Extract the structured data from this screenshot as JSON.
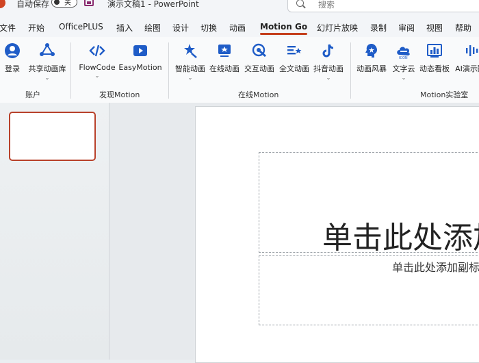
{
  "titlebar": {
    "autosave_label": "自动保存",
    "autosave_state": "关",
    "doc_title": "演示文稿1  -  PowerPoint",
    "search_placeholder": "搜索"
  },
  "tabs": [
    "文件",
    "开始",
    "OfficePLUS",
    "插入",
    "绘图",
    "设计",
    "切换",
    "动画",
    "Motion Go",
    "幻灯片放映",
    "录制",
    "审阅",
    "视图",
    "帮助"
  ],
  "active_tab": "Motion Go",
  "ribbon": {
    "groups": [
      "账户",
      "发现Motion",
      "在线Motion",
      "Motion实验室"
    ],
    "buttons": [
      {
        "label": "登录",
        "icon": "user-icon"
      },
      {
        "label": "共享动画库",
        "icon": "share-icon"
      },
      {
        "label": "FlowCode",
        "icon": "code-icon"
      },
      {
        "label": "EasyMotion",
        "icon": "video-icon"
      },
      {
        "label": "智能动画",
        "icon": "magic-star-icon"
      },
      {
        "label": "在线动画",
        "icon": "online-animation-icon"
      },
      {
        "label": "交互动画",
        "icon": "interactive-icon"
      },
      {
        "label": "全文动画",
        "icon": "full-text-icon"
      },
      {
        "label": "抖音动画",
        "icon": "tiktok-icon"
      },
      {
        "label": "动画风暴",
        "icon": "brain-icon"
      },
      {
        "label": "文字云",
        "icon": "word-cloud-icon"
      },
      {
        "label": "动态看板",
        "icon": "dashboard-icon"
      },
      {
        "label": "AI演示酷",
        "icon": "ai-voice-icon"
      }
    ]
  },
  "slide": {
    "title_placeholder": "单击此处添加标题",
    "subtitle_placeholder": "单击此处添加副标题"
  },
  "colors": {
    "accent": "#c43e1c",
    "icon_blue": "#1f5cc7",
    "thumb_border": "#b8412a"
  }
}
